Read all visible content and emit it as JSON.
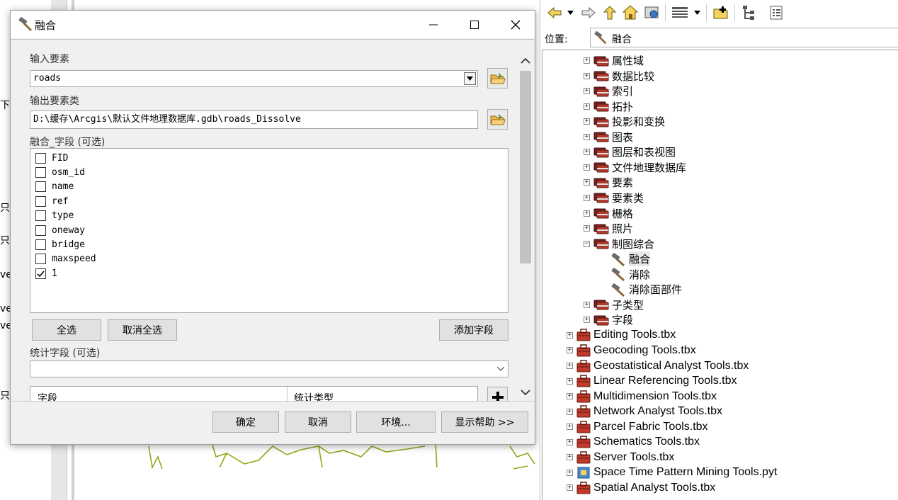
{
  "background": {
    "fragments": [
      "下",
      "只",
      "只-",
      "ve",
      "ve",
      "ve",
      "只"
    ]
  },
  "dialog": {
    "title": "融合",
    "input_label": "输入要素",
    "input_value": "roads",
    "output_label": "输出要素类",
    "output_value": "D:\\缓存\\Arcgis\\默认文件地理数据库.gdb\\roads_Dissolve",
    "dissolve_label": "融合_字段 (可选)",
    "fields": [
      {
        "name": "FID",
        "checked": false
      },
      {
        "name": "osm_id",
        "checked": false
      },
      {
        "name": "name",
        "checked": false
      },
      {
        "name": "ref",
        "checked": false
      },
      {
        "name": "type",
        "checked": false
      },
      {
        "name": "oneway",
        "checked": false
      },
      {
        "name": "bridge",
        "checked": false
      },
      {
        "name": "maxspeed",
        "checked": false
      },
      {
        "name": "1",
        "checked": true
      }
    ],
    "select_all": "全选",
    "unselect_all": "取消全选",
    "add_field": "添加字段",
    "stats_label": "统计字段 (可选)",
    "stats_value": "",
    "table_col_field": "字段",
    "table_col_stat": "统计类型",
    "ok": "确定",
    "cancel": "取消",
    "env": "环境...",
    "help": "显示帮助 >>"
  },
  "catalog": {
    "location_label": "位置:",
    "location_value": "融合",
    "nodes": [
      {
        "label": "属性域",
        "type": "toolset",
        "level": 2,
        "expander": "+"
      },
      {
        "label": "数据比较",
        "type": "toolset",
        "level": 2,
        "expander": "+"
      },
      {
        "label": "索引",
        "type": "toolset",
        "level": 2,
        "expander": "+"
      },
      {
        "label": "拓扑",
        "type": "toolset",
        "level": 2,
        "expander": "+"
      },
      {
        "label": "投影和变换",
        "type": "toolset",
        "level": 2,
        "expander": "+"
      },
      {
        "label": "图表",
        "type": "toolset",
        "level": 2,
        "expander": "+"
      },
      {
        "label": "图层和表视图",
        "type": "toolset",
        "level": 2,
        "expander": "+"
      },
      {
        "label": "文件地理数据库",
        "type": "toolset",
        "level": 2,
        "expander": "+"
      },
      {
        "label": "要素",
        "type": "toolset",
        "level": 2,
        "expander": "+"
      },
      {
        "label": "要素类",
        "type": "toolset",
        "level": 2,
        "expander": "+"
      },
      {
        "label": "栅格",
        "type": "toolset",
        "level": 2,
        "expander": "+"
      },
      {
        "label": "照片",
        "type": "toolset",
        "level": 2,
        "expander": "+"
      },
      {
        "label": "制图综合",
        "type": "toolset",
        "level": 2,
        "expander": "−"
      },
      {
        "label": "融合",
        "type": "tool",
        "level": 3,
        "expander": "",
        "selected": true
      },
      {
        "label": "消除",
        "type": "tool",
        "level": 3,
        "expander": ""
      },
      {
        "label": "消除面部件",
        "type": "tool",
        "level": 3,
        "expander": ""
      },
      {
        "label": "子类型",
        "type": "toolset",
        "level": 2,
        "expander": "+"
      },
      {
        "label": "字段",
        "type": "toolset",
        "level": 2,
        "expander": "+"
      },
      {
        "label": "Editing Tools.tbx",
        "type": "toolbox",
        "level": 1,
        "expander": "+"
      },
      {
        "label": "Geocoding Tools.tbx",
        "type": "toolbox",
        "level": 1,
        "expander": "+"
      },
      {
        "label": "Geostatistical Analyst Tools.tbx",
        "type": "toolbox",
        "level": 1,
        "expander": "+"
      },
      {
        "label": "Linear Referencing Tools.tbx",
        "type": "toolbox",
        "level": 1,
        "expander": "+"
      },
      {
        "label": "Multidimension Tools.tbx",
        "type": "toolbox",
        "level": 1,
        "expander": "+"
      },
      {
        "label": "Network Analyst Tools.tbx",
        "type": "toolbox",
        "level": 1,
        "expander": "+"
      },
      {
        "label": "Parcel Fabric Tools.tbx",
        "type": "toolbox",
        "level": 1,
        "expander": "+"
      },
      {
        "label": "Schematics Tools.tbx",
        "type": "toolbox",
        "level": 1,
        "expander": "+"
      },
      {
        "label": "Server Tools.tbx",
        "type": "toolbox",
        "level": 1,
        "expander": "+"
      },
      {
        "label": "Space Time Pattern Mining Tools.pyt",
        "type": "pytoolbox",
        "level": 1,
        "expander": "+"
      },
      {
        "label": "Spatial Analyst Tools.tbx",
        "type": "toolbox",
        "level": 1,
        "expander": "+"
      }
    ]
  },
  "colors": {
    "road": "#8aaa1a",
    "toolbox_red": "#c0392b",
    "toolset_dark": "#7a2020"
  }
}
